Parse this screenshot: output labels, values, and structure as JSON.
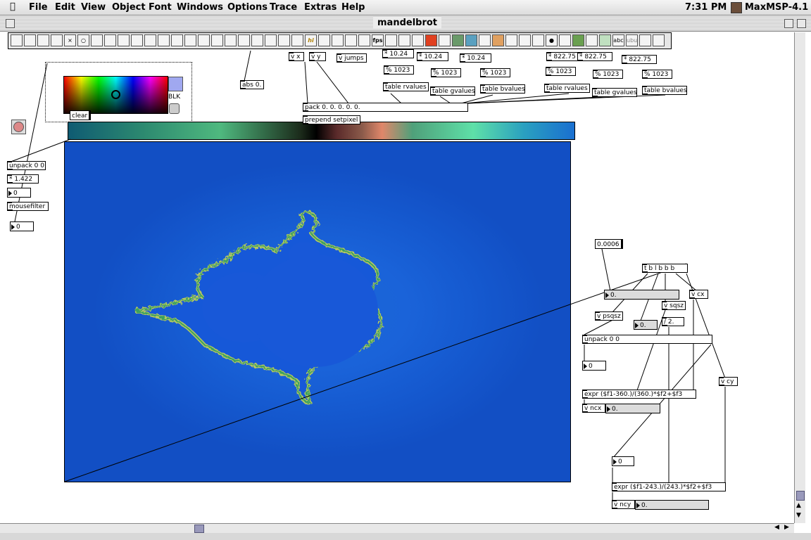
{
  "menubar": {
    "items": [
      "File",
      "Edit",
      "View",
      "Object",
      "Font",
      "Windows",
      "Options",
      "Trace",
      "Extras",
      "Help"
    ],
    "clock": "7:31 PM",
    "app_name": "MaxMSP-4.1"
  },
  "window": {
    "title": "mandelbrot"
  },
  "patch": {
    "vx": "v x",
    "vy": "v y",
    "vjumps": "v jumps",
    "abs": "abs 0.",
    "mul1": "* 10.24",
    "mul2": "* 10.24",
    "mul3": "* 10.24",
    "mul4": "* 822.75",
    "mul5": "* 822.75",
    "mul6": "* 822.75",
    "mod1": "% 1023",
    "mod2": "% 1023",
    "mod3": "% 1023",
    "mod4": "% 1023",
    "mod5": "% 1023",
    "mod6": "% 1023",
    "tr1": "table rvalues",
    "tg1": "table gvalues",
    "tb1": "table bvalues",
    "tr2": "table rvalues",
    "tg2": "table gvalues",
    "tb2": "table bvalues",
    "pack": "pack 0. 0. 0. 0. 0.",
    "prepend": "prepend setpixel",
    "clear": "clear",
    "blk": "BLK",
    "unpack1": "unpack 0 0",
    "mul1422": "* 1.422",
    "num_a": "0",
    "mousefilter": "mousefilter",
    "num_b": "0",
    "c0006": "0.0006",
    "tbl": "t b l b b b",
    "f0": "0.",
    "vsqsz": "v sqsz",
    "vcx": "v cx",
    "vpsqsz": "v psqsz",
    "div2": "/ 2.",
    "f0b": "0.",
    "unpack2": "unpack 0 0",
    "num_c": "0",
    "vcy": "v cy",
    "expr1": "expr ($f1-360.)/(360.)*$f2+$f3",
    "vncx": "v ncx",
    "f0c": "0.",
    "num_d": "0",
    "expr2": "expr ($f1-243.)/(243.)*$f2+$f3",
    "vncy": "v ncy",
    "f0d": "0."
  },
  "toolbar": {
    "hi": "hi",
    "fps": "fps",
    "abc": "abc",
    "ubu": "ubu"
  }
}
